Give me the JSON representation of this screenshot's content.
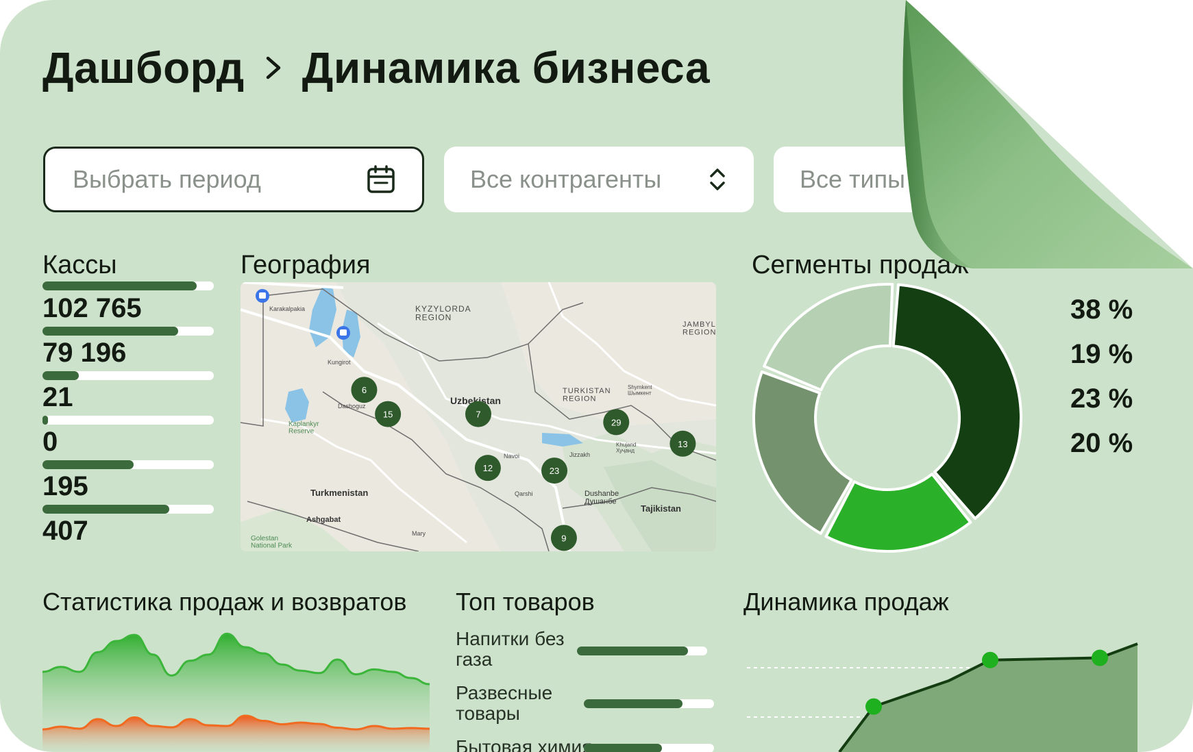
{
  "breadcrumb": {
    "root": "Дашборд",
    "current": "Динамика бизнеса"
  },
  "filters": {
    "period_placeholder": "Выбрать период",
    "counterparties": "Все контрагенты",
    "types": "Все типы"
  },
  "kassy": {
    "title": "Кассы",
    "items": [
      {
        "value": "102 765",
        "fill": 0.9
      },
      {
        "value": "79 196",
        "fill": 0.79
      },
      {
        "value": "21",
        "fill": 0.21
      },
      {
        "value": "0",
        "fill": 0.03
      },
      {
        "value": "195",
        "fill": 0.53
      },
      {
        "value": "407",
        "fill": 0.74
      }
    ]
  },
  "geography": {
    "title": "География",
    "labels": {
      "kyzylorda": "KYZYLORDA\nREGION",
      "jambyl": "JAMBYL\nREGION",
      "turkistan": "TURKISTAN\nREGION",
      "uzbekistan": "Uzbekistan",
      "turkmenistan": "Turkmenistan",
      "tajikistan": "Tajikistan",
      "ashgabat": "Ashgabat",
      "dushanbe": "Dushanbe\nДушанбе",
      "kaplankyr": "Kaplankyr\nReserve",
      "golestan": "Golestan\nNational Park",
      "karakalpakia": "Karakalpakia",
      "dashoguz": "Dashoguz",
      "kungirot": "Kungirot",
      "navoi": "Navoi",
      "jizzakh": "Jizzakh",
      "qarshi": "Qarshi",
      "mary": "Mary",
      "shymkent": "Shymkent\nШымкент",
      "khujand": "Khujand\nХуҷанд"
    },
    "clusters": [
      {
        "count": "6",
        "lon": 0.26,
        "lat": 0.4
      },
      {
        "count": "15",
        "lon": 0.31,
        "lat": 0.49
      },
      {
        "count": "7",
        "lon": 0.5,
        "lat": 0.49
      },
      {
        "count": "29",
        "lon": 0.79,
        "lat": 0.52
      },
      {
        "count": "13",
        "lon": 0.93,
        "lat": 0.6
      },
      {
        "count": "12",
        "lon": 0.52,
        "lat": 0.69
      },
      {
        "count": "23",
        "lon": 0.66,
        "lat": 0.7
      },
      {
        "count": "9",
        "lon": 0.68,
        "lat": 0.95
      }
    ]
  },
  "segments": {
    "title": "Сегменты продаж",
    "percents": [
      "38 %",
      "19 %",
      "23 %",
      "20 %"
    ],
    "chart_data": {
      "type": "pie",
      "values": [
        38,
        19,
        23,
        20
      ],
      "colors": [
        "#133f12",
        "#2bb02a",
        "#75926f",
        "#b5d0b2"
      ]
    }
  },
  "sales_stats": {
    "title": "Статистика продаж и возвратов",
    "chart_data": {
      "type": "area",
      "series": [
        {
          "color": "#3bb53a",
          "values": [
            0.3,
            0.38,
            0.3,
            0.62,
            0.8,
            0.9,
            0.58,
            0.24,
            0.48,
            0.58,
            0.92,
            0.7,
            0.6,
            0.42,
            0.32,
            0.28,
            0.5,
            0.26,
            0.34,
            0.3,
            0.2,
            0.1
          ]
        },
        {
          "color": "#f06a1f",
          "values": [
            0.2,
            0.28,
            0.22,
            0.5,
            0.3,
            0.55,
            0.3,
            0.26,
            0.5,
            0.32,
            0.3,
            0.6,
            0.45,
            0.35,
            0.4,
            0.36,
            0.25,
            0.2,
            0.3,
            0.22,
            0.24,
            0.22
          ]
        }
      ]
    }
  },
  "top_products": {
    "title": "Топ товаров",
    "items": [
      {
        "label": "Напитки без газа",
        "fill": 0.85
      },
      {
        "label": "Развесные товары",
        "fill": 0.76
      },
      {
        "label": "Бытовая химия",
        "fill": 0.6
      }
    ]
  },
  "sales_dynamics": {
    "title": "Динамика продаж",
    "chart_data": {
      "type": "area",
      "x": [
        0,
        1,
        2,
        3,
        4,
        5
      ],
      "values": [
        0.0,
        0.42,
        0.66,
        0.85,
        0.87,
        1.0
      ]
    }
  }
}
